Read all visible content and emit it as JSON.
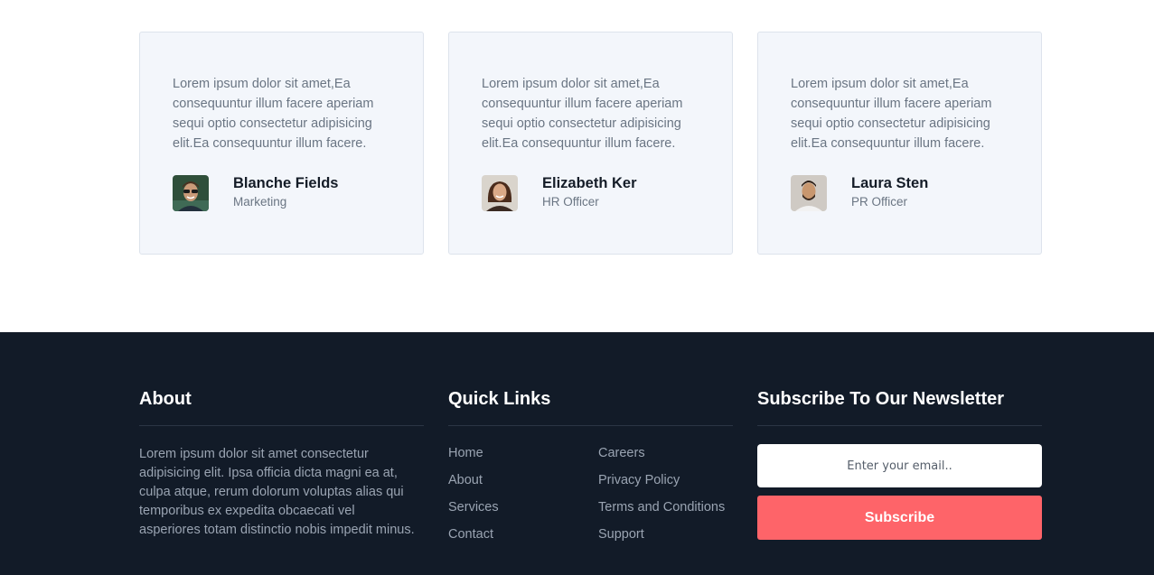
{
  "testimonials": [
    {
      "quote": "Lorem ipsum dolor sit amet,Ea consequuntur illum facere aperiam sequi optio consectetur adipisicing elit.Ea consequuntur illum facere.",
      "name": "Blanche Fields",
      "role": "Marketing",
      "avatar_colors": {
        "bg": "#2f4f3a",
        "skin": "#c99a78",
        "hair": "#4a3020"
      }
    },
    {
      "quote": "Lorem ipsum dolor sit amet,Ea consequuntur illum facere aperiam sequi optio consectetur adipisicing elit.Ea consequuntur illum facere.",
      "name": "Elizabeth Ker",
      "role": "HR Officer",
      "avatar_colors": {
        "bg": "#d9d4cc",
        "skin": "#d9a987",
        "hair": "#4a2c1c"
      }
    },
    {
      "quote": "Lorem ipsum dolor sit amet,Ea consequuntur illum facere aperiam sequi optio consectetur adipisicing elit.Ea consequuntur illum facere.",
      "name": "Laura Sten",
      "role": "PR Officer",
      "avatar_colors": {
        "bg": "#cfcac4",
        "skin": "#c8976f",
        "hair": "#2a1c14"
      }
    }
  ],
  "footer": {
    "about": {
      "title": "About",
      "text": "Lorem ipsum dolor sit amet consectetur adipisicing elit. Ipsa officia dicta magni ea at, culpa atque, rerum dolorum voluptas alias qui temporibus ex expedita obcaecati vel asperiores totam distinctio nobis impedit minus."
    },
    "quick_links": {
      "title": "Quick Links",
      "items": [
        "Home",
        "Careers",
        "About",
        "Privacy Policy",
        "Services",
        "Terms and Conditions",
        "Contact",
        "Support"
      ]
    },
    "newsletter": {
      "title": "Subscribe To Our Newsletter",
      "email_placeholder": "Enter your email..",
      "button_label": "Subscribe"
    }
  },
  "colors": {
    "footer_bg": "#121b28",
    "card_bg": "#f3f6fb",
    "accent": "#fe6469"
  }
}
